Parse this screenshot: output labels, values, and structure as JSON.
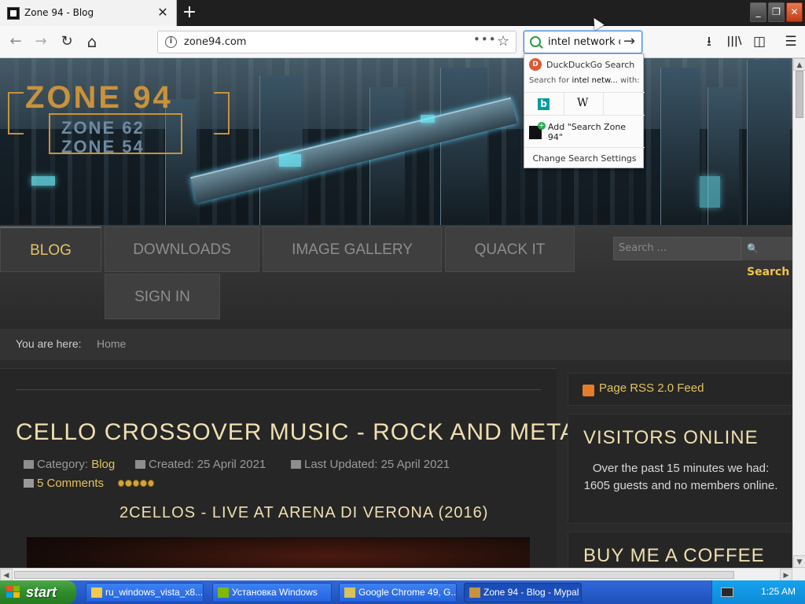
{
  "browser": {
    "tab": {
      "title": "Zone 94 - Blog",
      "close": "✕"
    },
    "new_tab": "+",
    "window_buttons": {
      "minimize": "_",
      "maximize": "❐",
      "close": "✕"
    },
    "nav": {
      "back": "←",
      "forward": "→",
      "reload": "↻",
      "home": "⌂"
    },
    "url": "zone94.com",
    "page_actions": "•••",
    "bookmark_star": "☆",
    "search_query": "intel network d",
    "search_go": "→",
    "tools": {
      "downloads": "⭳",
      "library": "|||\\",
      "sidebar": "◫",
      "menu": "☰"
    }
  },
  "search_dropdown": {
    "engine": "DuckDuckGo Search",
    "engine_icon": "D",
    "search_for_prefix": "Search for",
    "search_for_query": "intel netw...",
    "search_for_suffix": "with:",
    "alt_engines": [
      {
        "name": "bing-icon",
        "glyph": "b"
      },
      {
        "name": "wikipedia-icon",
        "glyph": "W"
      }
    ],
    "add_engine": "Add \"Search Zone 94\"",
    "settings": "Change Search Settings"
  },
  "site": {
    "logo": {
      "main": "ZONE 94",
      "sub1": "ZONE 62",
      "sub2": "ZONE 54"
    },
    "menu": [
      {
        "label": "BLOG",
        "active": true
      },
      {
        "label": "DOWNLOADS"
      },
      {
        "label": "IMAGE GALLERY"
      },
      {
        "label": "QUACK IT"
      },
      {
        "label": "SIGN IN"
      }
    ],
    "search": {
      "placeholder": "Search ...",
      "button": "Search",
      "button_icon": "🔍"
    },
    "breadcrumb": {
      "label": "You are here:",
      "home": "Home"
    },
    "article": {
      "title": "CELLO CROSSOVER MUSIC - ROCK AND METAL",
      "category_label": "Category:",
      "category": "Blog",
      "created": "Created: 25 April 2021",
      "updated": "Last Updated: 25 April 2021",
      "comments": "5 Comments",
      "rating": 5,
      "video_title": "2CELLOS - LIVE AT ARENA DI VERONA (2016)"
    },
    "sidebar": {
      "rss": "Page RSS 2.0 Feed",
      "visitors_title": "VISITORS ONLINE",
      "visitors_text": "Over the past 15 minutes we had: 1605 guests and no members online.",
      "coffee_title": "BUY ME A COFFEE"
    }
  },
  "scroll": {
    "up": "▲",
    "down": "▼",
    "left": "◀",
    "right": "▶"
  },
  "taskbar": {
    "start": "start",
    "items": [
      {
        "label": "ru_windows_vista_x8..."
      },
      {
        "label": "Установка Windows"
      },
      {
        "label": "Google Chrome 49, G..."
      },
      {
        "label": "Zone 94 - Blog - Mypal",
        "active": true
      }
    ],
    "clock": "1:25 AM"
  },
  "colors": {
    "accent_gold": "#e3c45a",
    "title_cream": "#f0dfb0",
    "xp_blue": "#2a5fcf",
    "xp_green": "#2f8c2b"
  }
}
